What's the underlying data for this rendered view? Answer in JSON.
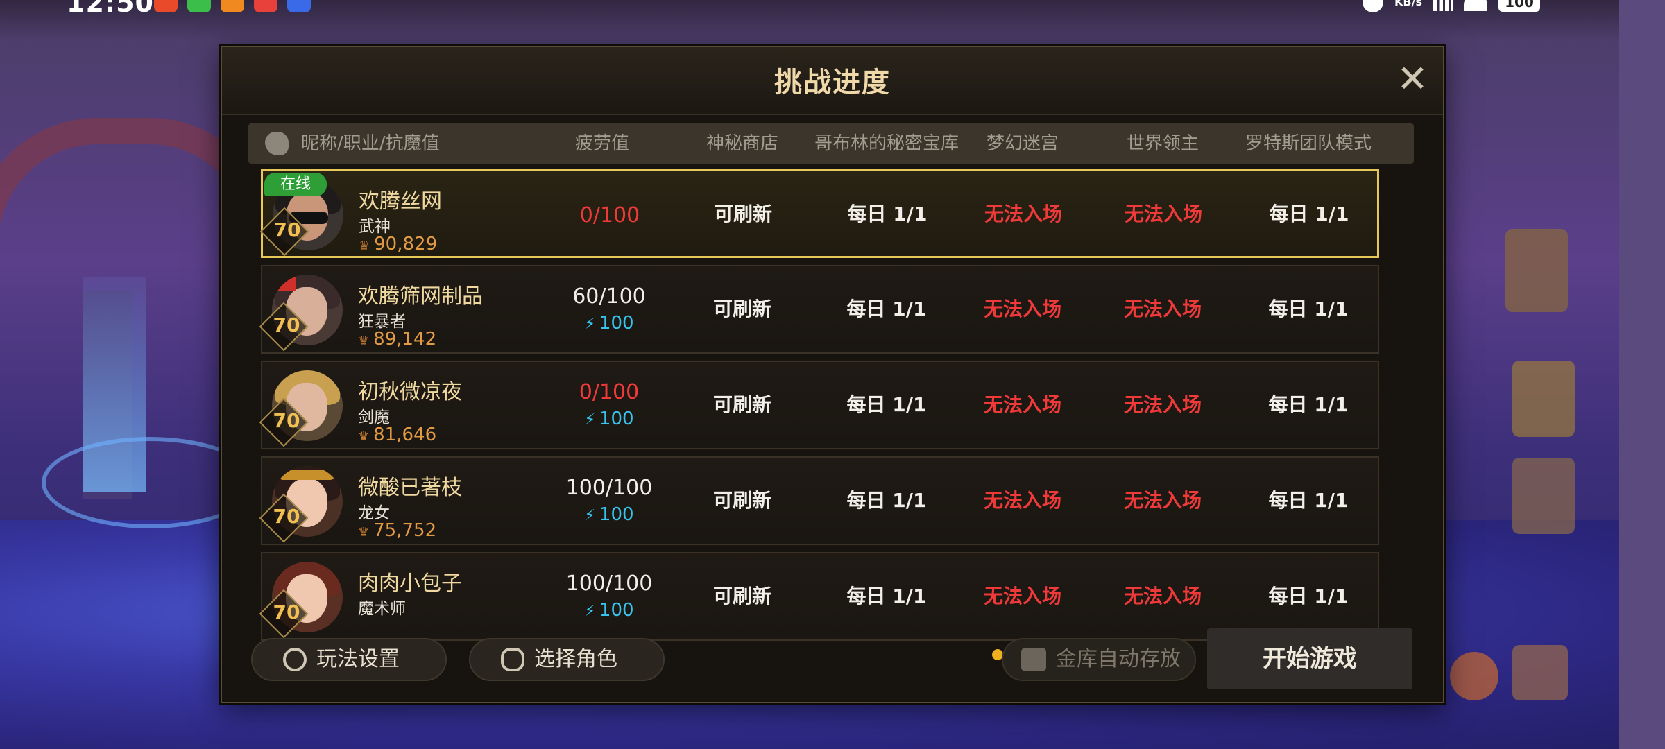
{
  "status_bar": {
    "time": "12:50",
    "net_speed_top": "",
    "net_speed_unit": "KB/s",
    "battery": "100"
  },
  "dialog": {
    "title": "挑战进度",
    "close_icon": "close-icon",
    "columns": {
      "nickname": "昵称/职业/抗魔值",
      "fatigue": "疲劳值",
      "shop": "神秘商店",
      "goblin": "哥布林的秘密宝库",
      "maze": "梦幻迷宫",
      "world_boss": "世界领主",
      "lotus": "罗特斯团队模式"
    },
    "rows": [
      {
        "online": "在线",
        "level": "70",
        "name": "欢腾丝网",
        "class": "武神",
        "power": "90,829",
        "fatigue": "0/100",
        "fatigue_sub": "",
        "shop": "可刷新",
        "goblin": "每日 1/1",
        "maze": "无法入场",
        "world_boss": "无法入场",
        "lotus": "每日 1/1"
      },
      {
        "online": "",
        "level": "70",
        "name": "欢腾筛网制品",
        "class": "狂暴者",
        "power": "89,142",
        "fatigue": "60/100",
        "fatigue_sub": "100",
        "shop": "可刷新",
        "goblin": "每日 1/1",
        "maze": "无法入场",
        "world_boss": "无法入场",
        "lotus": "每日 1/1"
      },
      {
        "online": "",
        "level": "70",
        "name": "初秋微凉夜",
        "class": "剑魔",
        "power": "81,646",
        "fatigue": "0/100",
        "fatigue_sub": "100",
        "shop": "可刷新",
        "goblin": "每日 1/1",
        "maze": "无法入场",
        "world_boss": "无法入场",
        "lotus": "每日 1/1"
      },
      {
        "online": "",
        "level": "70",
        "name": "微酸已著枝",
        "class": "龙女",
        "power": "75,752",
        "fatigue": "100/100",
        "fatigue_sub": "100",
        "shop": "可刷新",
        "goblin": "每日 1/1",
        "maze": "无法入场",
        "world_boss": "无法入场",
        "lotus": "每日 1/1"
      },
      {
        "online": "",
        "level": "70",
        "name": "肉肉小包子",
        "class": "魔术师",
        "power": "",
        "fatigue": "100/100",
        "fatigue_sub": "100",
        "shop": "可刷新",
        "goblin": "每日 1/1",
        "maze": "无法入场",
        "world_boss": "无法入场",
        "lotus": "每日 1/1"
      }
    ],
    "footer": {
      "settings_label": "玩法设置",
      "select_char_label": "选择角色",
      "vault_label": "金库自动存放",
      "start_label": "开始游戏",
      "page_dots": 3,
      "page_active": 1
    }
  },
  "colors": {
    "accent_gold": "#e6c758",
    "red_text": "#f03a3a",
    "fatigue_blue": "#37c4ee",
    "online_green": "#2e9e37",
    "title_text": "#f0d9a8"
  }
}
